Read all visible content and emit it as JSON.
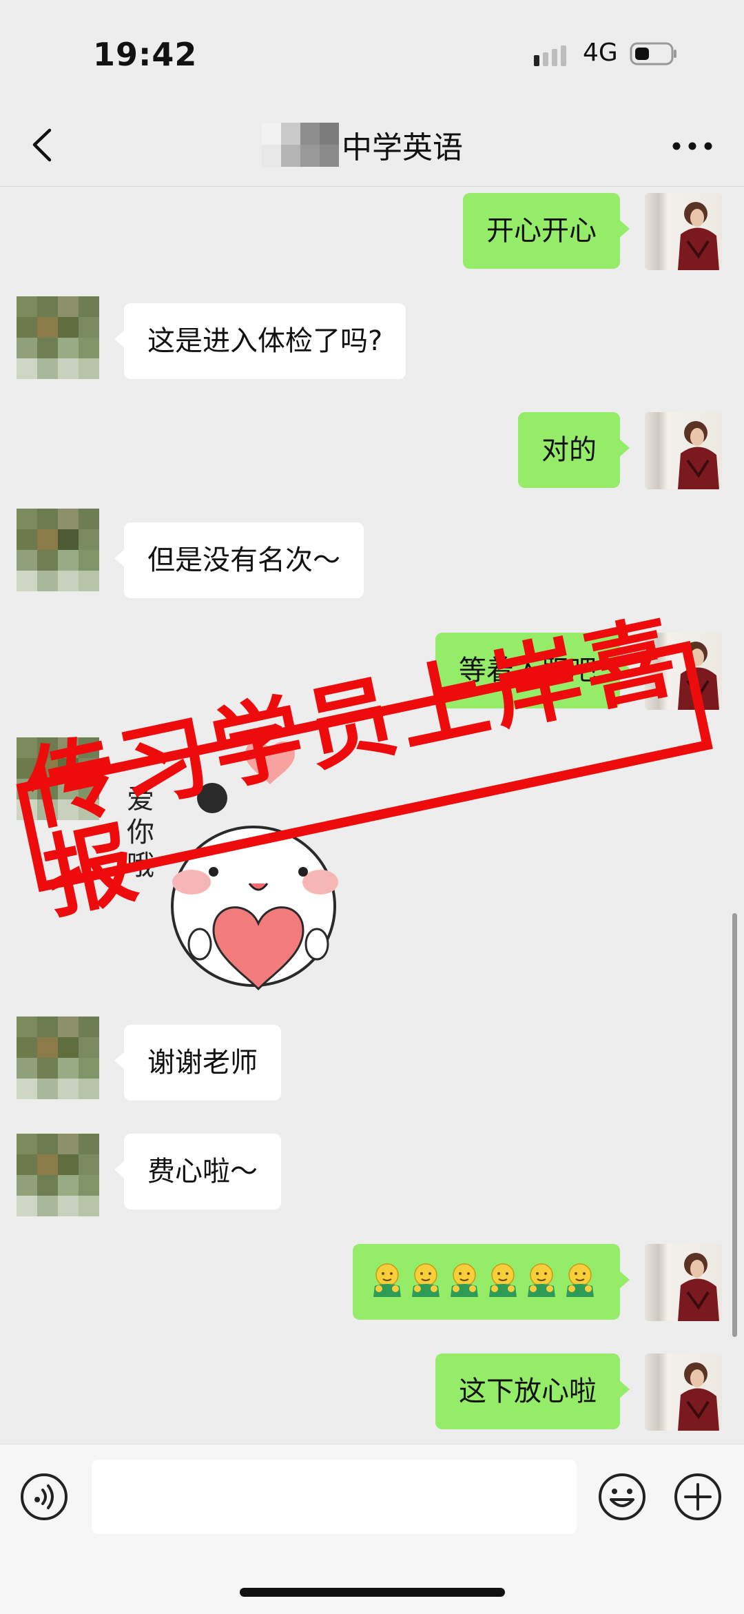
{
  "status_bar": {
    "time": "19:42",
    "network": "4G"
  },
  "header": {
    "title": "中学英语"
  },
  "messages": [
    {
      "side": "me",
      "text": "开心开心"
    },
    {
      "side": "them",
      "text": "这是进入体检了吗?"
    },
    {
      "side": "me",
      "text": "对的"
    },
    {
      "side": "them",
      "text": "但是没有名次～"
    },
    {
      "side": "me",
      "text": "等着入职吧"
    },
    {
      "side": "them",
      "type": "sticker",
      "text": "爱你哦"
    },
    {
      "side": "them",
      "text": "谢谢老师"
    },
    {
      "side": "them",
      "text": "费心啦～"
    },
    {
      "side": "me",
      "type": "emoji",
      "emoji_count": 6
    },
    {
      "side": "me",
      "text": "这下放心啦"
    }
  ],
  "overlay": {
    "stamp_text": "传习学员上岸喜报"
  },
  "input": {
    "placeholder": ""
  },
  "icons": {
    "back": "chevron-left-icon",
    "more": "more-icon",
    "voice": "voice-icon",
    "emoji": "emoji-icon",
    "plus": "plus-icon"
  },
  "colors": {
    "my_bubble": "#95ec69",
    "their_bubble": "#ffffff",
    "background": "#ededed",
    "stamp": "#ee0b0b"
  }
}
